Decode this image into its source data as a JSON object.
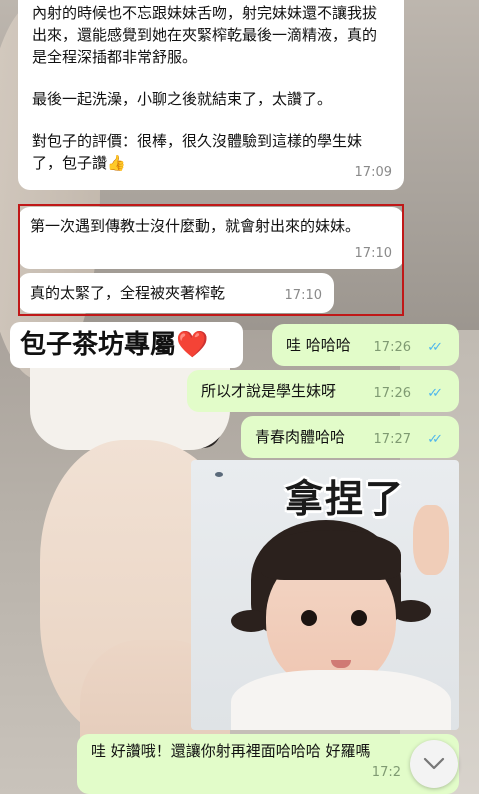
{
  "messages": {
    "review": {
      "paragraphs": [
        "內射的時候也不忘跟妹妹舌吻，射完妹妹還不讓我拔出來，還能感覺到她在夾緊榨乾最後一滴精液，真的是全程深插都非常舒服。",
        "最後一起洗澡，小聊之後就結束了，太讚了。",
        "對包子的評價：很棒，很久沒體驗到這樣的學生妹了，包子讚👍"
      ],
      "time": "17:09"
    },
    "highlight_1": {
      "text": "第一次遇到傳教士沒什麼動，就會射出來的妹妹。",
      "time": "17:10"
    },
    "highlight_2": {
      "text": "真的太緊了，全程被夾著榨乾",
      "time": "17:10"
    },
    "overlay_label": {
      "text": "包子茶坊專屬",
      "emoji": "❤️"
    },
    "out_1": {
      "text": "哇 哈哈哈",
      "time": "17:26"
    },
    "out_2": {
      "text": "所以才說是學生妹呀",
      "time": "17:26"
    },
    "out_3": {
      "text": "青春肉體哈哈",
      "time": "17:27"
    },
    "sticker": {
      "caption": "拿捏了"
    },
    "out_4": {
      "text": "哇 好讚哦！還讓你射再裡面哈哈哈 好羅嗎",
      "time": "17:2"
    }
  },
  "colors": {
    "incoming_bubble": "#ffffff",
    "outgoing_bubble": "#e2fcc9",
    "read_ticks": "#4fb6ec",
    "highlight_border": "#c01818"
  },
  "icons": {
    "read_receipt": "double-check-icon",
    "scroll_down": "chevron-down-icon"
  }
}
